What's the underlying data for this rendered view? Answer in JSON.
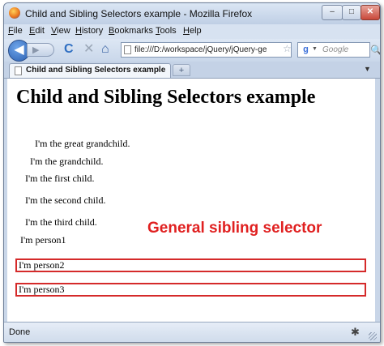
{
  "window": {
    "title": "Child and Sibling Selectors example - Mozilla Firefox",
    "controls": {
      "minimize": "–",
      "maximize": "□",
      "close": "✕"
    }
  },
  "menu": {
    "items": [
      {
        "label": "File",
        "accel": "F",
        "rest": "ile"
      },
      {
        "label": "Edit",
        "accel": "E",
        "rest": "dit"
      },
      {
        "label": "View",
        "accel": "V",
        "rest": "iew"
      },
      {
        "label": "History",
        "accel": "H",
        "rest": "istory"
      },
      {
        "label": "Bookmarks",
        "accel": "B",
        "rest": "ookmarks"
      },
      {
        "label": "Tools",
        "accel": "T",
        "rest": "ools"
      },
      {
        "label": "Help",
        "accel": "H",
        "rest": "elp"
      }
    ]
  },
  "nav": {
    "back_glyph": "◀",
    "forward_glyph": "▶",
    "reload_glyph": "C",
    "stop_glyph": "✕",
    "home_glyph": "⌂",
    "url": "file:///D:/workspace/jQuery/jQuery-ge",
    "url_dropdown_glyph": "▼",
    "bookmark_star_glyph": "☆",
    "search_engine_glyph": "g",
    "search_dropdown_glyph": "▼",
    "search_placeholder": "Google",
    "search_button_glyph": "🔍"
  },
  "tabs": {
    "active_label": "Child and Sibling Selectors example",
    "new_tab_glyph": "+",
    "list_glyph": "▼"
  },
  "page": {
    "heading": "Child and Sibling Selectors example",
    "lines": {
      "great_grandchild": "I'm the great grandchild.",
      "grandchild": "I'm the grandchild.",
      "first_child": "I'm the first child.",
      "second_child": "I'm the second child.",
      "third_child": "I'm the third child.",
      "person1": "I'm person1",
      "person2": "I'm person2",
      "person3": "I'm person3"
    },
    "annotation": "General sibling selector",
    "colors": {
      "highlight": "#d52a2a",
      "annotation": "#e02020"
    }
  },
  "status": {
    "text": "Done",
    "activity_glyph": "✱"
  }
}
